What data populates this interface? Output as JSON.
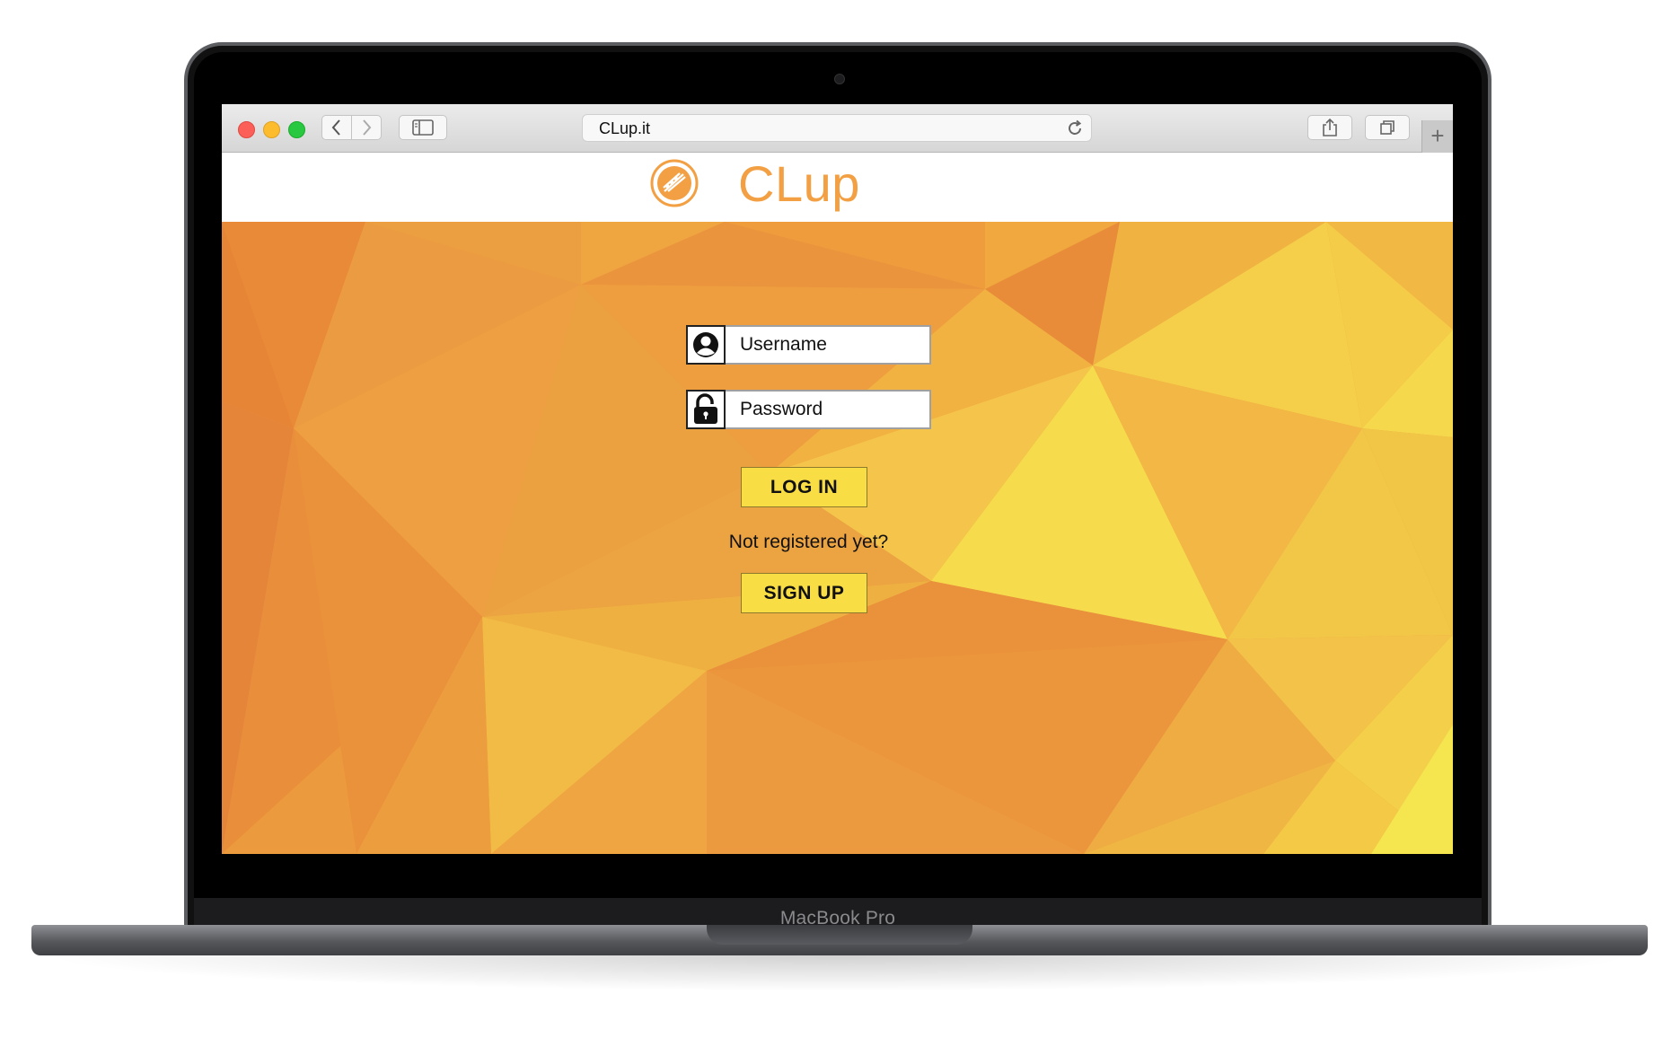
{
  "device": {
    "brand_label": "MacBook Pro"
  },
  "browser": {
    "url": "CLup.it"
  },
  "site": {
    "title": "CLup",
    "brand_color": "#f2a043"
  },
  "login_form": {
    "username_placeholder": "Username",
    "password_placeholder": "Password",
    "login_label": "LOG IN",
    "signup_prompt": "Not registered yet?",
    "signup_label": "SIGN UP"
  },
  "colors": {
    "button": "#f9dd45",
    "hero_orange": "#e9893a",
    "hero_yellow": "#f5dc4b"
  },
  "icons": {
    "username": "user-icon",
    "password": "lock-icon",
    "logo": "clup-logo-icon",
    "reload": "reload-icon"
  }
}
